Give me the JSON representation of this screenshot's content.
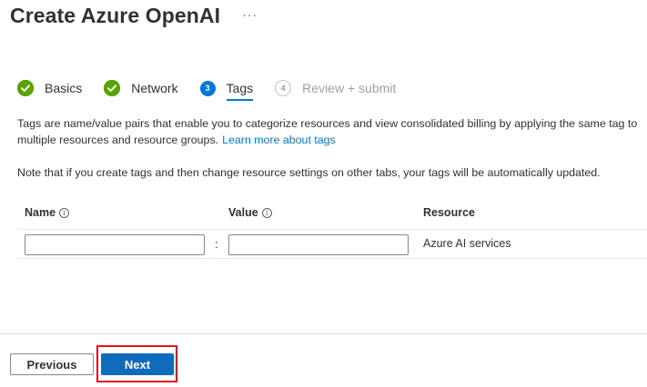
{
  "header": {
    "title": "Create Azure OpenAI",
    "more_label": "···"
  },
  "steps": [
    {
      "label": "Basics",
      "state": "complete",
      "icon": "checkmark-circle-icon"
    },
    {
      "label": "Network",
      "state": "complete",
      "icon": "checkmark-circle-icon"
    },
    {
      "label": "Tags",
      "state": "current",
      "number": "3"
    },
    {
      "label": "Review + submit",
      "state": "future",
      "number": "4"
    }
  ],
  "description": {
    "text": "Tags are name/value pairs that enable you to categorize resources and view consolidated billing by applying the same tag to multiple resources and resource groups.",
    "link": "Learn more about tags"
  },
  "note": "Note that if you create tags and then change resource settings on other tabs, your tags will be automatically updated.",
  "table": {
    "columns": {
      "name": "Name",
      "value": "Value",
      "resource": "Resource"
    },
    "info_glyph": "i",
    "row": {
      "name_value": "",
      "separator": ":",
      "value_value": "",
      "resource": "Azure AI services"
    }
  },
  "footer": {
    "previous_label": "Previous",
    "next_label": "Next"
  },
  "colors": {
    "complete": "#57a300",
    "accent": "#0078d4",
    "primary_button": "#0f6cbd",
    "highlight": "#e81123"
  }
}
